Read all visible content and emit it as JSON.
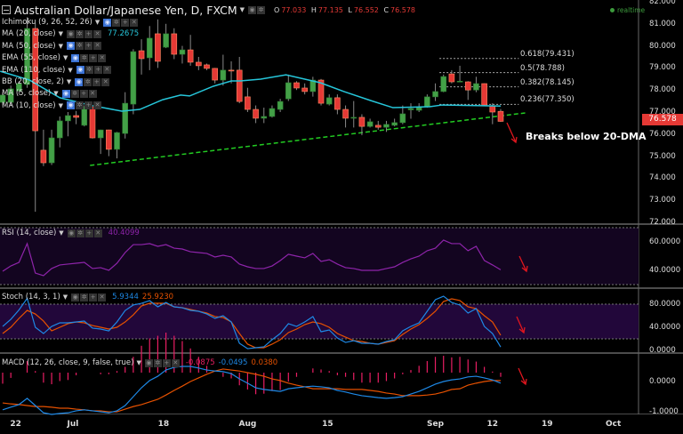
{
  "header": {
    "title": "Australian Dollar/Japanese Yen, D, FXCM",
    "ohlc": {
      "o_label": "O",
      "o": "77.033",
      "h_label": "H",
      "h": "77.135",
      "l_label": "L",
      "l": "76.552",
      "c_label": "C",
      "c": "76.578"
    },
    "status": "realtime"
  },
  "legend": {
    "main": [
      {
        "name": "Ichimoku (9, 26, 52, 26)",
        "visible": true
      },
      {
        "name": "MA (20, close)",
        "visible": false,
        "value": "77.2675"
      },
      {
        "name": "MA (50, close)",
        "visible": true
      },
      {
        "name": "EMA (55, close)",
        "visible": true
      },
      {
        "name": "EMA (110, close)",
        "visible": true
      },
      {
        "name": "BB (20, close, 2)",
        "visible": true
      },
      {
        "name": "MA (5, close)",
        "visible": true
      },
      {
        "name": "MA (10, close)",
        "visible": true
      }
    ],
    "rsi": {
      "name": "RSI (14, close)",
      "value": "40.4099"
    },
    "stoch": {
      "name": "Stoch (14, 3, 1)",
      "k": "5.9344",
      "d": "25.9230"
    },
    "macd": {
      "name": "MACD (12, 26, close, 9, false, true)",
      "hist": "-0.0875",
      "macd": "-0.0495",
      "signal": "0.0380"
    }
  },
  "annotation": {
    "text": "Breaks below 20-DMA"
  },
  "price_tag": "76.578",
  "colors": {
    "up": "#43a047",
    "down": "#e53935",
    "ma20": "#26c6da",
    "trend": "#22cc22",
    "rsi": "#8e24aa",
    "k": "#1e88e5",
    "d": "#e65100",
    "hist": "#e91e63",
    "arrow": "#e0161e"
  },
  "chart_data": {
    "type": "candlestick",
    "title": "Australian Dollar/Japanese Yen, D, FXCM",
    "price_axis": {
      "ticks": [
        "82.000",
        "81.000",
        "80.000",
        "79.000",
        "78.000",
        "77.000",
        "76.000",
        "75.000",
        "74.000",
        "73.000",
        "72.000"
      ],
      "range": [
        72,
        82
      ]
    },
    "x_ticks": [
      {
        "label": "22",
        "index": 1.6
      },
      {
        "label": "Jul",
        "index": 8.6
      },
      {
        "label": "18",
        "index": 19.7
      },
      {
        "label": "Aug",
        "index": 30
      },
      {
        "label": "15",
        "index": 39.8
      },
      {
        "label": "Sep",
        "index": 53
      },
      {
        "label": "12",
        "index": 60
      },
      {
        "label": "19",
        "index": 66.7
      },
      {
        "label": "Oct",
        "index": 74.8
      }
    ],
    "candles": [
      [
        77.44,
        77.9,
        77.3,
        77.77
      ],
      [
        77.44,
        78.2,
        77.3,
        78.05
      ],
      [
        77.96,
        78.4,
        77.8,
        78.29
      ],
      [
        78.25,
        81.3,
        78.1,
        80.79
      ],
      [
        80.79,
        81.0,
        72.48,
        76.15
      ],
      [
        75.27,
        76.2,
        74.55,
        74.7
      ],
      [
        74.7,
        76.2,
        74.6,
        75.83
      ],
      [
        75.83,
        76.8,
        75.4,
        76.6
      ],
      [
        76.6,
        77.0,
        75.9,
        76.84
      ],
      [
        76.84,
        77.05,
        76.45,
        76.76
      ],
      [
        76.4,
        77.3,
        76.35,
        77.24
      ],
      [
        77.24,
        77.3,
        75.8,
        75.83
      ],
      [
        75.83,
        76.2,
        75.1,
        76.19
      ],
      [
        76.19,
        76.2,
        75.0,
        75.31
      ],
      [
        75.31,
        76.1,
        74.9,
        76.07
      ],
      [
        76.03,
        77.9,
        75.8,
        77.4
      ],
      [
        77.36,
        79.85,
        76.9,
        79.74
      ],
      [
        79.78,
        80.3,
        78.7,
        79.42
      ],
      [
        79.46,
        80.9,
        78.9,
        80.35
      ],
      [
        80.55,
        81.2,
        79.0,
        79.3
      ],
      [
        79.94,
        81.0,
        79.9,
        80.55
      ],
      [
        80.55,
        80.8,
        79.4,
        79.62
      ],
      [
        79.62,
        80.0,
        79.2,
        79.82
      ],
      [
        79.82,
        80.5,
        79.1,
        79.26
      ],
      [
        79.26,
        79.5,
        78.9,
        79.1
      ],
      [
        79.14,
        79.2,
        78.9,
        78.98
      ],
      [
        78.98,
        79.0,
        78.3,
        78.45
      ],
      [
        78.45,
        79.6,
        78.2,
        78.9
      ],
      [
        78.9,
        79.3,
        78.3,
        78.86
      ],
      [
        78.9,
        79.5,
        77.4,
        77.48
      ],
      [
        77.69,
        78.1,
        77.0,
        77.12
      ],
      [
        77.12,
        77.3,
        76.5,
        76.72
      ],
      [
        76.72,
        77.2,
        76.5,
        76.8
      ],
      [
        76.8,
        77.3,
        76.75,
        77.16
      ],
      [
        77.12,
        77.6,
        77.0,
        77.48
      ],
      [
        77.6,
        78.7,
        77.5,
        78.33
      ],
      [
        78.33,
        78.4,
        78.0,
        78.09
      ],
      [
        78.09,
        78.3,
        77.8,
        77.93
      ],
      [
        77.93,
        78.6,
        77.7,
        78.45
      ],
      [
        78.45,
        78.5,
        77.3,
        77.4
      ],
      [
        77.36,
        77.8,
        77.3,
        77.65
      ],
      [
        77.65,
        77.8,
        76.9,
        77.12
      ],
      [
        77.12,
        77.3,
        76.3,
        76.72
      ],
      [
        76.72,
        77.5,
        76.3,
        76.76
      ],
      [
        76.76,
        76.9,
        75.95,
        76.35
      ],
      [
        76.35,
        76.7,
        76.3,
        76.56
      ],
      [
        76.4,
        76.6,
        76.2,
        76.31
      ],
      [
        76.31,
        76.6,
        76.1,
        76.44
      ],
      [
        76.4,
        76.7,
        76.35,
        76.52
      ],
      [
        76.52,
        77.3,
        76.45,
        76.92
      ],
      [
        77.1,
        77.4,
        76.7,
        77.16
      ],
      [
        77.08,
        77.4,
        77.0,
        77.24
      ],
      [
        77.24,
        77.8,
        77.2,
        77.69
      ],
      [
        77.69,
        78.3,
        77.5,
        77.93
      ],
      [
        77.93,
        78.7,
        77.9,
        78.61
      ],
      [
        78.73,
        78.9,
        78.3,
        78.37
      ],
      [
        78.37,
        79.1,
        78.35,
        78.4
      ],
      [
        78.37,
        78.4,
        77.55,
        78.0
      ],
      [
        78.0,
        78.6,
        77.9,
        78.29
      ],
      [
        78.29,
        78.3,
        77.3,
        77.32
      ],
      [
        77.28,
        77.4,
        76.45,
        77.0
      ],
      [
        77.033,
        77.135,
        76.552,
        76.578
      ]
    ],
    "ma20": [
      [
        -0.3,
        78.85
      ],
      [
        3.3,
        78.45
      ],
      [
        7,
        77.65
      ],
      [
        10.6,
        77.32
      ],
      [
        14.6,
        77.04
      ],
      [
        16.8,
        77.12
      ],
      [
        19.6,
        77.56
      ],
      [
        21.8,
        77.77
      ],
      [
        22.9,
        77.73
      ],
      [
        25.8,
        78.17
      ],
      [
        28,
        78.41
      ],
      [
        29.1,
        78.41
      ],
      [
        31.6,
        78.49
      ],
      [
        34.7,
        78.69
      ],
      [
        38.9,
        78.33
      ],
      [
        41.8,
        77.93
      ],
      [
        45.1,
        77.52
      ],
      [
        47.8,
        77.2
      ],
      [
        52.3,
        77.24
      ],
      [
        53.8,
        77.32
      ],
      [
        61,
        77.27
      ]
    ],
    "trendline": [
      [
        10.7,
        74.58
      ],
      [
        64,
        76.96
      ]
    ],
    "fibonacci": [
      {
        "label": "0.618(79.431)",
        "level": 79.431
      },
      {
        "label": "0.5(78.788)",
        "level": 78.788
      },
      {
        "label": "0.382(78.145)",
        "level": 78.145
      },
      {
        "label": "0.236(77.350)",
        "level": 77.35
      }
    ],
    "fib_range": [
      53.5,
      63
    ],
    "rsi": {
      "ticks": [
        "60.0000",
        "40.0000"
      ],
      "tick_values": [
        60,
        40
      ],
      "bands": [
        70,
        30
      ],
      "values": [
        39.4,
        43.1,
        45.6,
        58.8,
        38.1,
        36.3,
        41.3,
        43.8,
        44.4,
        45,
        45.6,
        41.3,
        41.9,
        40,
        45,
        52.5,
        58.1,
        58.1,
        58.8,
        56.9,
        58.1,
        55.6,
        55,
        53.1,
        52.5,
        51.9,
        49.4,
        50.6,
        49.4,
        44.4,
        42.5,
        41.3,
        41.3,
        43.1,
        46.9,
        51.3,
        50,
        48.8,
        51.9,
        46.3,
        47.5,
        44.4,
        41.9,
        41.3,
        40,
        40,
        40,
        41.3,
        42.5,
        45.6,
        48.1,
        50,
        53.8,
        55.6,
        61.3,
        58.8,
        58.8,
        53.8,
        56.9,
        46.9,
        43.8,
        40.4
      ]
    },
    "stoch": {
      "ticks": [
        "80.0000",
        "40.0000",
        "0.0000"
      ],
      "tick_values": [
        80,
        40,
        0
      ],
      "bands": [
        80,
        20
      ],
      "k": [
        41.5,
        53.8,
        70,
        90,
        40,
        29.2,
        41.5,
        47.7,
        47.7,
        49.2,
        50.8,
        38.5,
        36.9,
        33.8,
        49.2,
        69,
        78.5,
        81.5,
        86,
        75.4,
        83,
        75.4,
        73.8,
        69.2,
        67.7,
        63,
        55.4,
        60,
        49.2,
        12.3,
        3,
        4.6,
        6.2,
        18.5,
        29.2,
        46.2,
        41.5,
        49.2,
        58.5,
        32.3,
        35.4,
        21.5,
        13.8,
        16.9,
        12.3,
        12.3,
        10.8,
        15.4,
        18.5,
        33.8,
        41.5,
        47.7,
        67.7,
        87.7,
        93.8,
        83,
        78.5,
        64.6,
        72.3,
        41.5,
        29.2,
        5.9
      ],
      "d": [
        29.2,
        40,
        55.4,
        69.2,
        63,
        50.8,
        33.8,
        40,
        46.2,
        49.2,
        47.7,
        43,
        40,
        36.9,
        40,
        49.2,
        61.5,
        76.9,
        81.5,
        81.5,
        81.5,
        75.4,
        73.8,
        70.8,
        67.7,
        64.6,
        58.5,
        56.9,
        49.2,
        29.2,
        10.8,
        4.6,
        4.6,
        10.8,
        18.5,
        30.8,
        36.9,
        44.6,
        49.2,
        46.2,
        40,
        29.2,
        23,
        16.9,
        15.4,
        12.3,
        10.8,
        13.8,
        16.9,
        27.7,
        36.9,
        44.6,
        55.4,
        67.7,
        84.6,
        89.2,
        86.2,
        75.4,
        72.3,
        60,
        49.2,
        26.2
      ]
    },
    "macd": {
      "ticks": [
        "0.0000",
        "-1.0000"
      ],
      "tick_values": [
        0,
        -1
      ],
      "macd": [
        -0.86,
        -0.78,
        -0.7,
        -0.51,
        -0.73,
        -0.95,
        -1.0,
        -0.97,
        -0.95,
        -0.89,
        -0.86,
        -0.89,
        -0.92,
        -0.95,
        -0.89,
        -0.73,
        -0.46,
        -0.19,
        0.03,
        0.16,
        0.35,
        0.43,
        0.46,
        0.46,
        0.41,
        0.35,
        0.32,
        0.3,
        0.24,
        0.08,
        -0.05,
        -0.19,
        -0.24,
        -0.27,
        -0.3,
        -0.22,
        -0.19,
        -0.16,
        -0.14,
        -0.16,
        -0.19,
        -0.27,
        -0.32,
        -0.38,
        -0.43,
        -0.46,
        -0.49,
        -0.51,
        -0.49,
        -0.46,
        -0.38,
        -0.3,
        -0.19,
        -0.08,
        0,
        0.05,
        0.08,
        0.14,
        0.16,
        0.11,
        0.05,
        -0.05
      ],
      "signal": [
        -0.65,
        -0.68,
        -0.7,
        -0.73,
        -0.76,
        -0.76,
        -0.78,
        -0.81,
        -0.81,
        -0.84,
        -0.86,
        -0.89,
        -0.89,
        -0.92,
        -0.92,
        -0.84,
        -0.76,
        -0.7,
        -0.62,
        -0.54,
        -0.41,
        -0.27,
        -0.14,
        0,
        0.11,
        0.22,
        0.32,
        0.38,
        0.35,
        0.32,
        0.27,
        0.22,
        0.16,
        0.08,
        0.03,
        -0.05,
        -0.11,
        -0.16,
        -0.22,
        -0.22,
        -0.22,
        -0.22,
        -0.24,
        -0.24,
        -0.24,
        -0.27,
        -0.3,
        -0.35,
        -0.38,
        -0.43,
        -0.43,
        -0.43,
        -0.41,
        -0.38,
        -0.32,
        -0.24,
        -0.22,
        -0.11,
        -0.05,
        0,
        0.03,
        0.03
      ]
    }
  }
}
